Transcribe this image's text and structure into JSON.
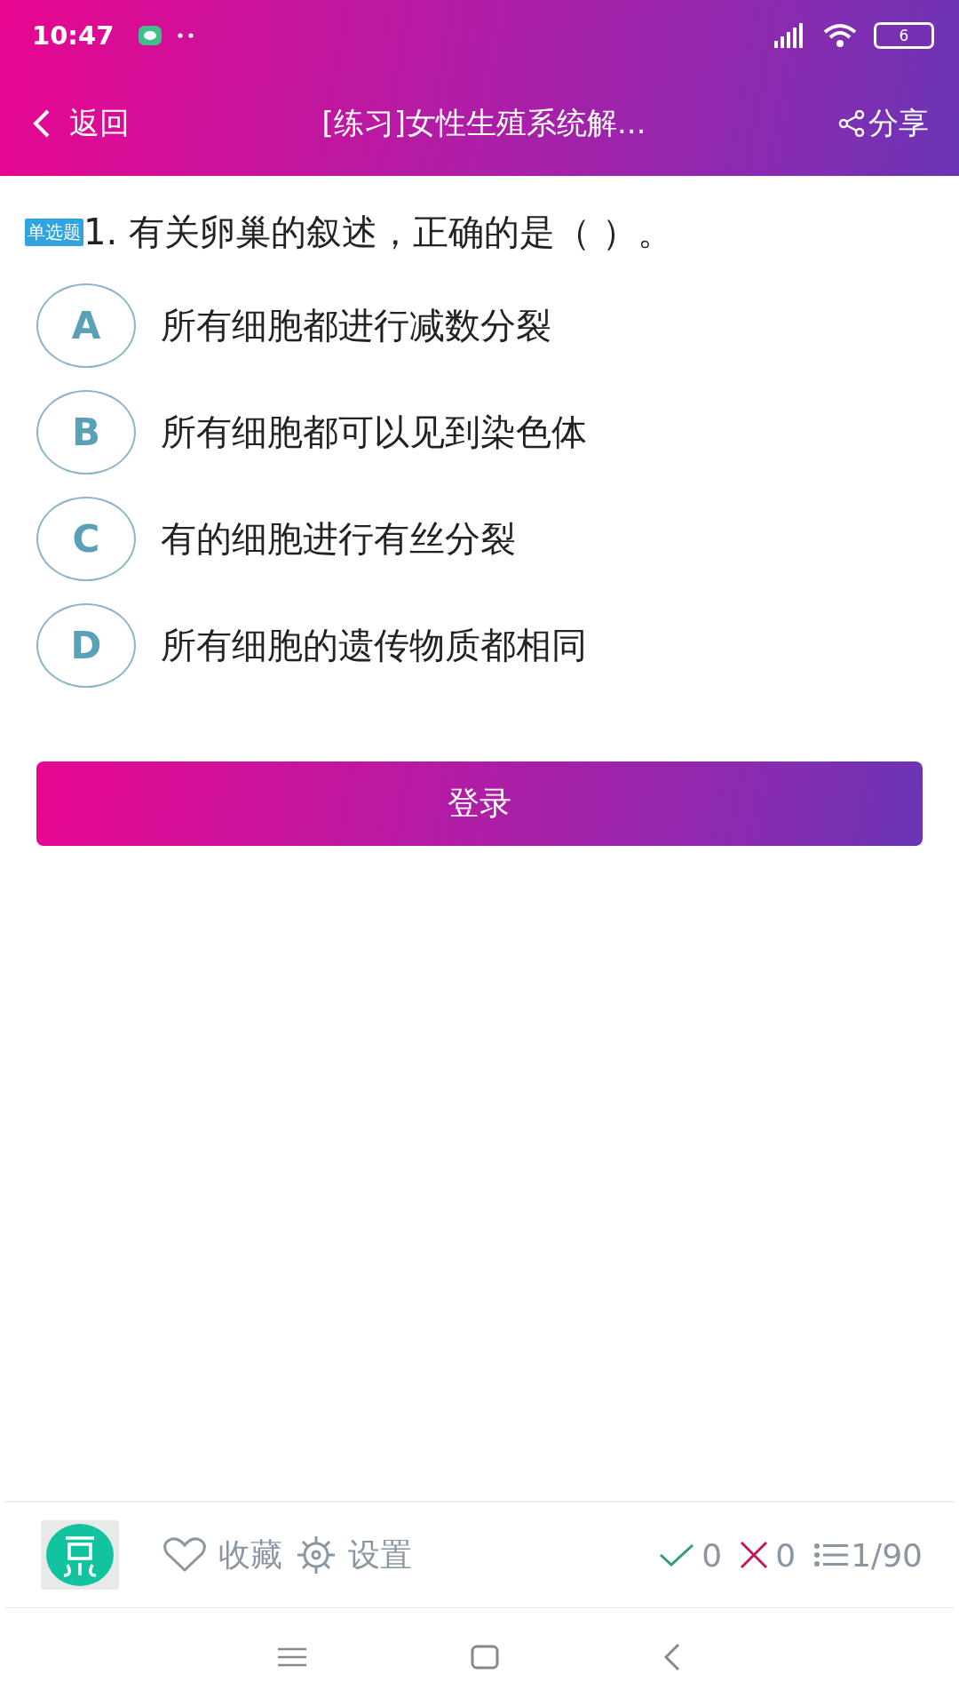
{
  "status_bar": {
    "time": "10:47",
    "battery": "6"
  },
  "header": {
    "back": "返回",
    "title": "[练习]女性生殖系统解...",
    "share": "分享"
  },
  "question": {
    "type_badge": "单选题",
    "text": "1. 有关卵巢的叙述，正确的是（ ）。",
    "options": [
      {
        "letter": "A",
        "text": "所有细胞都进行减数分裂"
      },
      {
        "letter": "B",
        "text": "所有细胞都可以见到染色体"
      },
      {
        "letter": "C",
        "text": "有的细胞进行有丝分裂"
      },
      {
        "letter": "D",
        "text": "所有细胞的遗传物质都相同"
      }
    ]
  },
  "login_button": "登录",
  "bottom_bar": {
    "favorite": "收藏",
    "settings": "设置",
    "correct": "0",
    "wrong": "0",
    "progress": "1/90"
  }
}
